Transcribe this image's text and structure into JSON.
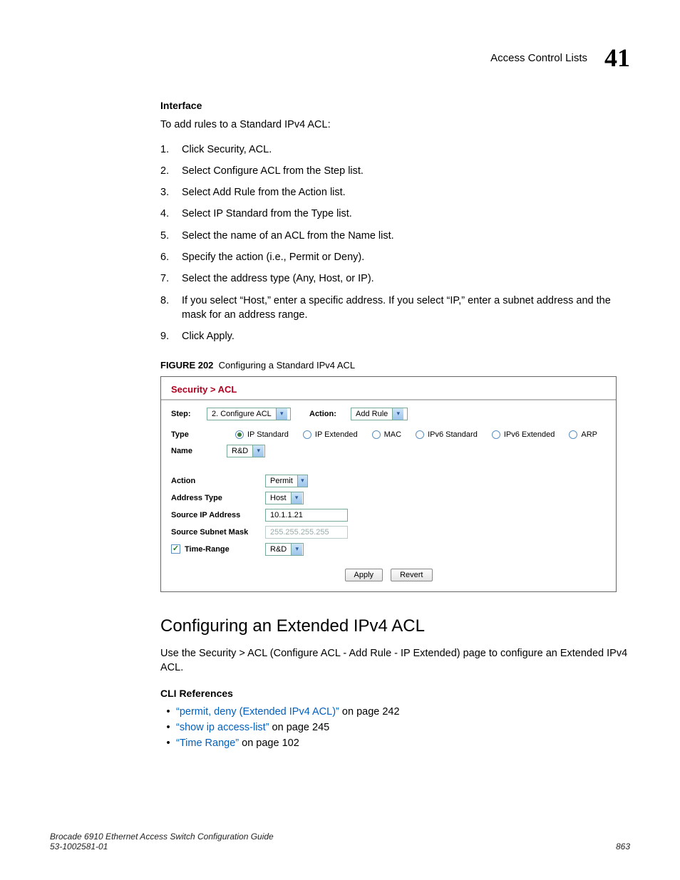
{
  "header": {
    "section_title": "Access Control Lists",
    "chapter": "41"
  },
  "interface": {
    "label": "Interface",
    "intro": "To add rules to a Standard IPv4 ACL:",
    "steps": [
      "Click Security, ACL.",
      "Select Configure ACL from the Step list.",
      "Select Add Rule from the Action list.",
      "Select IP Standard from the Type list.",
      "Select the name of an ACL from the Name list.",
      "Specify the action (i.e., Permit or Deny).",
      "Select the address type (Any, Host, or IP).",
      "If you select “Host,” enter a specific address. If you select “IP,” enter a subnet address and the mask for an address range.",
      "Click Apply."
    ]
  },
  "figure": {
    "caption_prefix": "FIGURE 202",
    "caption_text": "Configuring a Standard IPv4 ACL",
    "breadcrumb": "Security > ACL",
    "step_label": "Step:",
    "step_value": "2. Configure ACL",
    "action_label": "Action:",
    "action_value": "Add Rule",
    "type_label": "Type",
    "type_options": [
      "IP Standard",
      "IP Extended",
      "MAC",
      "IPv6 Standard",
      "IPv6 Extended",
      "ARP"
    ],
    "name_label": "Name",
    "name_value": "R&D",
    "fields": {
      "action_label": "Action",
      "action_value": "Permit",
      "addrtype_label": "Address Type",
      "addrtype_value": "Host",
      "srcip_label": "Source IP Address",
      "srcip_value": "10.1.1.21",
      "srcmask_label": "Source Subnet Mask",
      "srcmask_value": "255.255.255.255",
      "timerange_label": "Time-Range",
      "timerange_value": "R&D"
    },
    "buttons": {
      "apply": "Apply",
      "revert": "Revert"
    }
  },
  "section2": {
    "heading": "Configuring an Extended IPv4 ACL",
    "para": "Use the Security > ACL (Configure ACL - Add Rule - IP Extended) page to configure an Extended IPv4 ACL.",
    "cli_label": "CLI References",
    "refs": [
      {
        "link": "“permit, deny (Extended IPv4 ACL)”",
        "rest": " on page 242"
      },
      {
        "link": "“show ip access-list”",
        "rest": " on page 245"
      },
      {
        "link": "“Time Range”",
        "rest": " on page 102"
      }
    ]
  },
  "footer": {
    "left_line1": "Brocade 6910 Ethernet Access Switch Configuration Guide",
    "left_line2": "53-1002581-01",
    "right": "863"
  }
}
